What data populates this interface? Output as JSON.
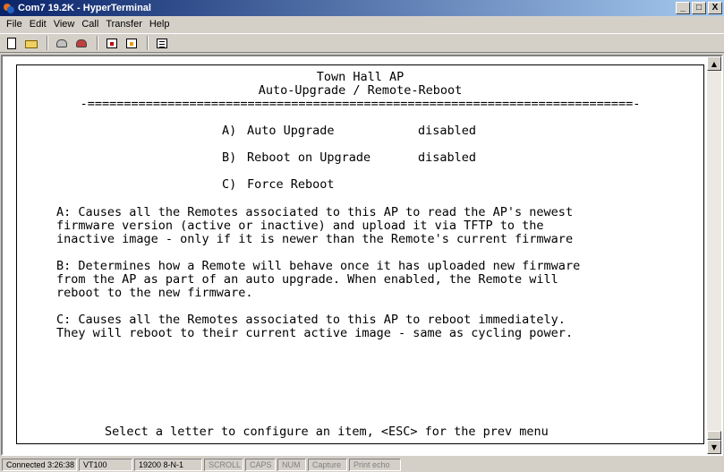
{
  "window": {
    "title": "Com7 19.2K - HyperTerminal",
    "minimize": "_",
    "maximize": "□",
    "close": "X"
  },
  "menu": [
    "File",
    "Edit",
    "View",
    "Call",
    "Transfer",
    "Help"
  ],
  "toolbar": {
    "icons": [
      "new-connection-icon",
      "open-icon",
      "connect-icon",
      "disconnect-icon",
      "send-icon",
      "receive-icon",
      "properties-icon"
    ]
  },
  "terminal": {
    "title": "Town Hall AP",
    "subtitle": "Auto-Upgrade / Remote-Reboot",
    "divider": "-===========================================================================-",
    "options": [
      {
        "key": "A)",
        "label": "Auto Upgrade",
        "value": "disabled"
      },
      {
        "key": "B)",
        "label": "Reboot on Upgrade",
        "value": "disabled"
      },
      {
        "key": "C)",
        "label": "Force Reboot",
        "value": ""
      }
    ],
    "help_a": [
      "A: Causes all the Remotes associated to this AP to read the AP's newest",
      "firmware version (active or inactive) and upload it via TFTP to the",
      "inactive image - only if it is newer than the Remote's current firmware"
    ],
    "help_b": [
      "B: Determines how a Remote will behave once it has uploaded new firmware",
      "from the AP as part of an auto upgrade. When enabled, the Remote will",
      "reboot to the new firmware."
    ],
    "help_c": [
      "C: Causes all the Remotes associated to this AP to reboot immediately.",
      "They will reboot to their current active image - same as cycling power."
    ],
    "prompt": "Select a letter to configure an item, <ESC> for the prev menu"
  },
  "status": {
    "connected": "Connected 3:26:38",
    "emulation": "VT100",
    "settings": "19200 8-N-1",
    "scroll": "SCROLL",
    "caps": "CAPS",
    "num": "NUM",
    "capture": "Capture",
    "print_echo": "Print echo"
  }
}
